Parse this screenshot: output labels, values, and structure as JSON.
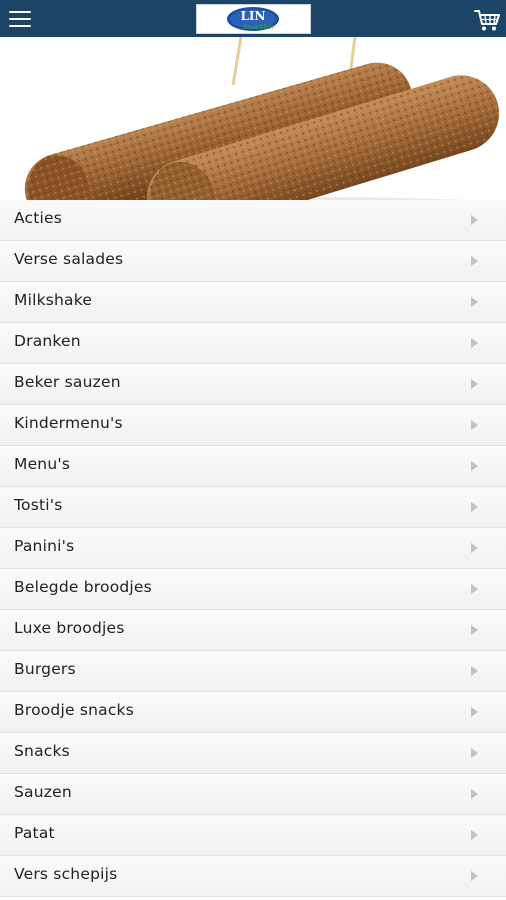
{
  "header": {
    "menu_icon": "hamburger-menu-icon",
    "logo_text": "LIN",
    "logo_subtext": "Snackbar",
    "cart_icon": "shopping-cart-icon",
    "bar_color": "#1b4466"
  },
  "hero": {
    "image": "two-fried-croquette-snacks-with-skewers"
  },
  "categories": [
    {
      "label": "Acties"
    },
    {
      "label": "Verse salades"
    },
    {
      "label": "Milkshake"
    },
    {
      "label": "Dranken"
    },
    {
      "label": "Beker sauzen"
    },
    {
      "label": "Kindermenu's"
    },
    {
      "label": "Menu's"
    },
    {
      "label": "Tosti's"
    },
    {
      "label": "Panini's"
    },
    {
      "label": "Belegde broodjes"
    },
    {
      "label": "Luxe broodjes"
    },
    {
      "label": "Burgers"
    },
    {
      "label": "Broodje snacks"
    },
    {
      "label": "Snacks"
    },
    {
      "label": "Sauzen"
    },
    {
      "label": "Patat"
    },
    {
      "label": "Vers schepijs"
    }
  ]
}
